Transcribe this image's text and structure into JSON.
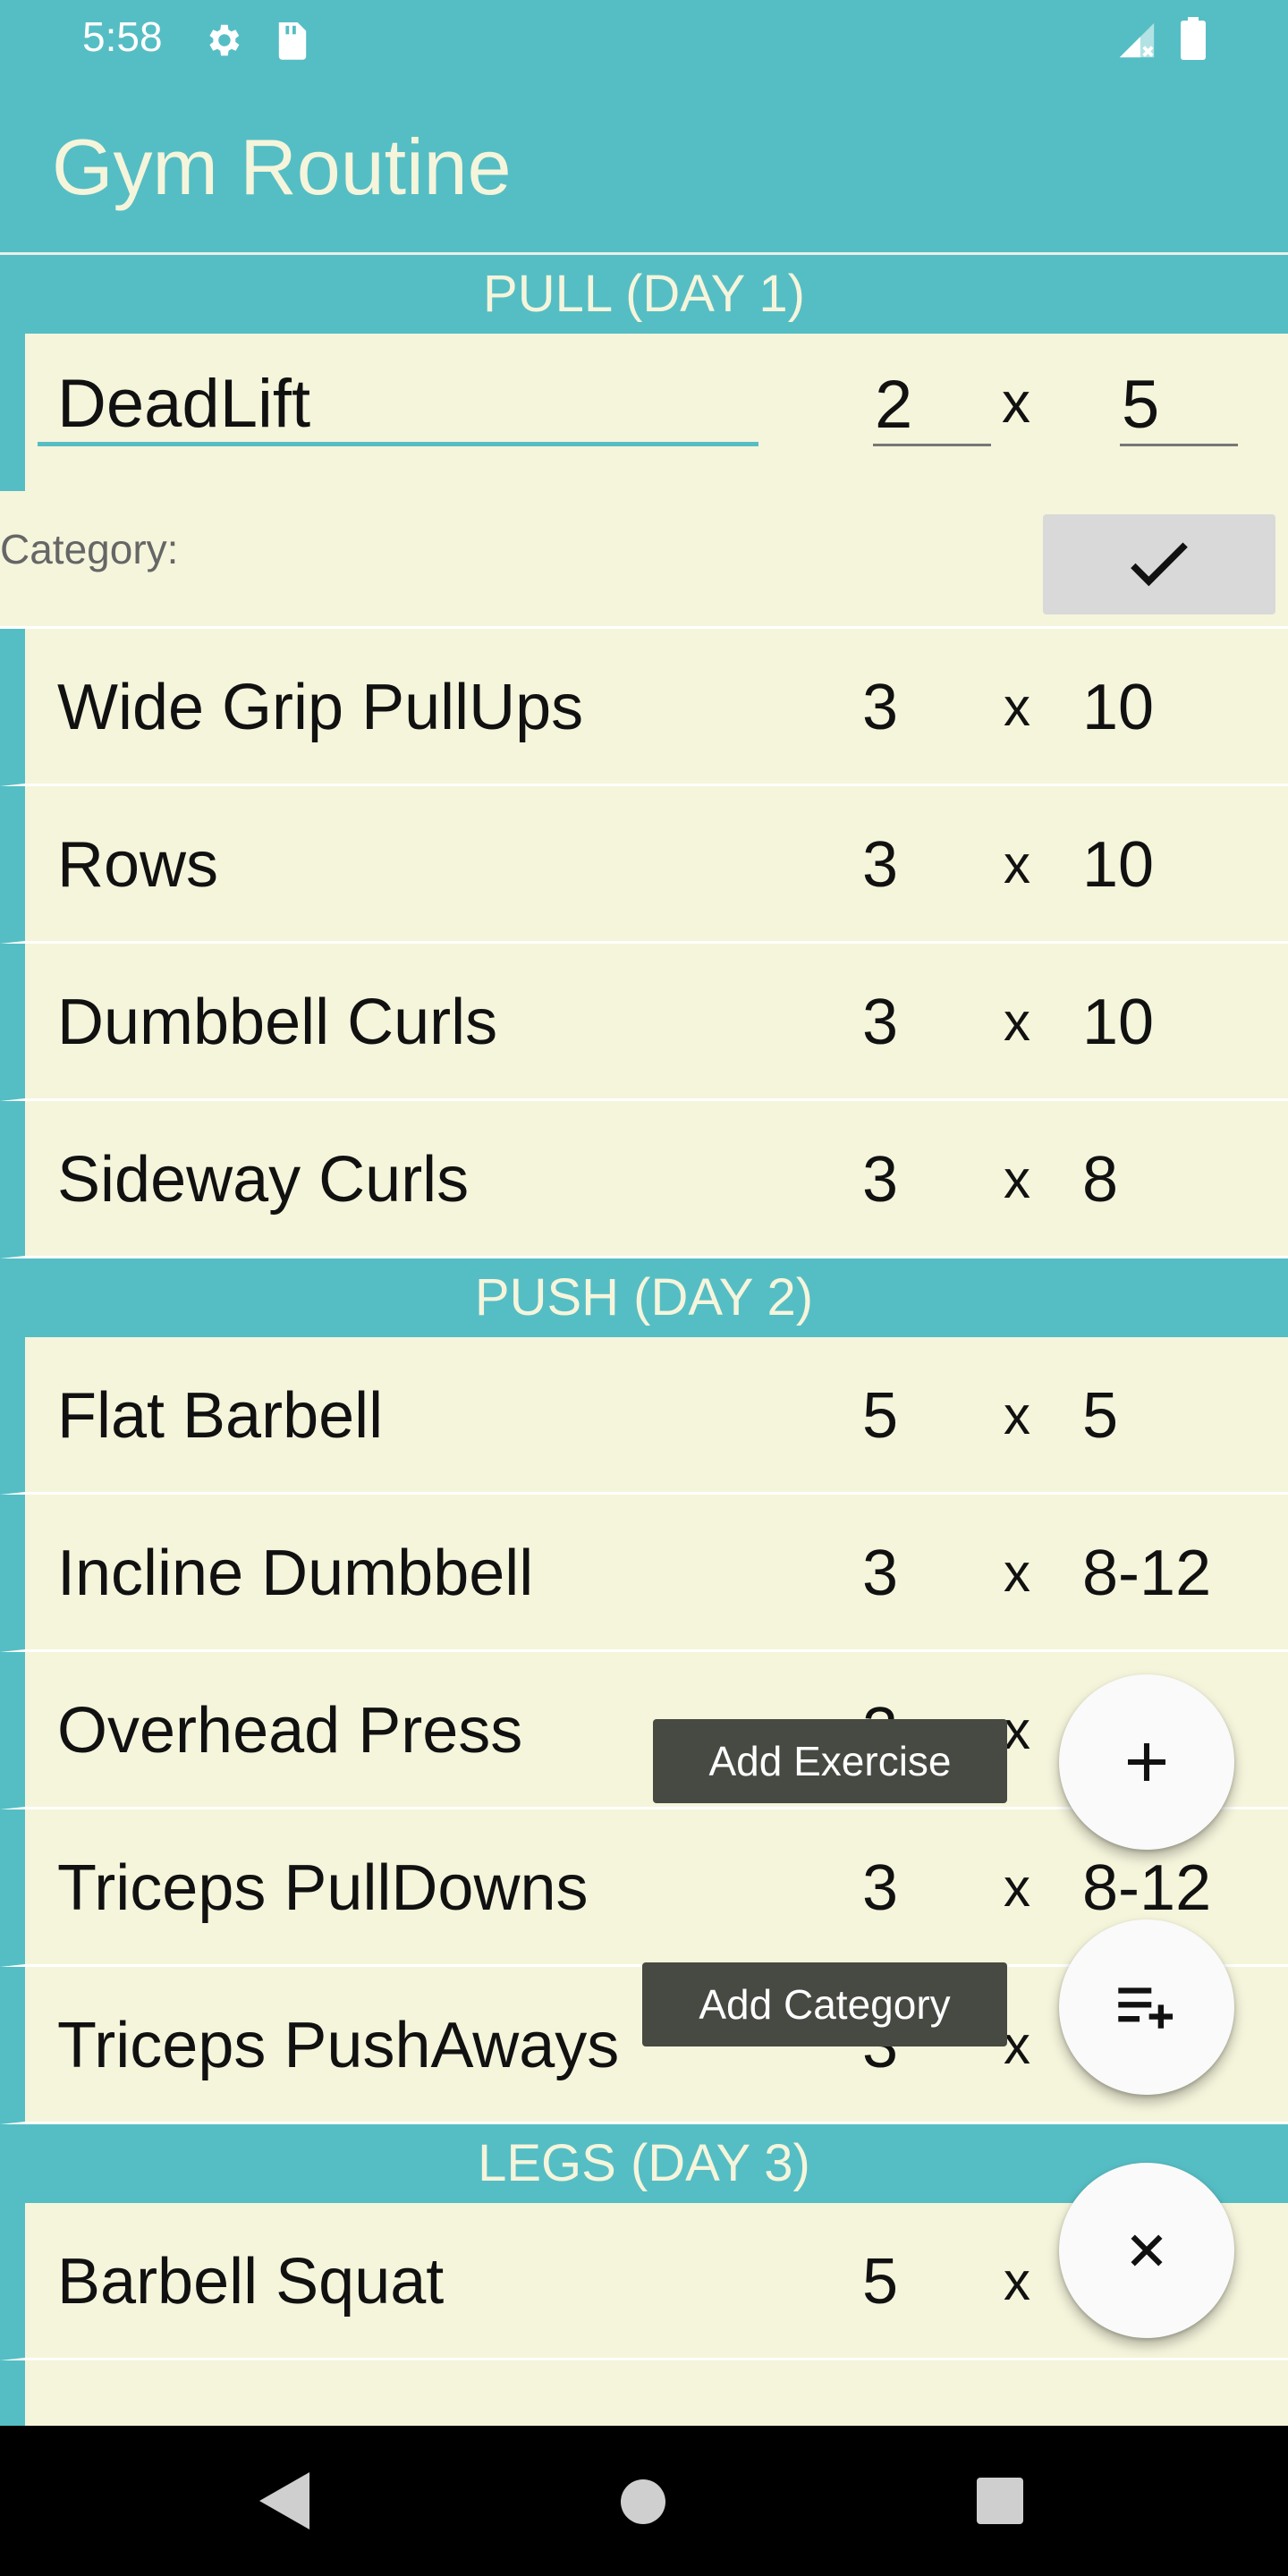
{
  "status_bar": {
    "time": "5:58",
    "icons": [
      "gear-icon",
      "sd-card-icon",
      "signal-icon",
      "battery-icon"
    ]
  },
  "app": {
    "title": "Gym Routine"
  },
  "colors": {
    "primary": "#55bec4",
    "background": "#f5f5dc",
    "label_bg": "#474a42",
    "button_gray": "#d9d9d9"
  },
  "editing": {
    "category_header": "PULL (DAY 1)",
    "name": "DeadLift",
    "sets": "2",
    "x": "x",
    "reps": "5",
    "category_label": "Category:",
    "confirm_icon": "check-icon"
  },
  "categories": [
    {
      "title": "PULL (DAY 1)",
      "exercises": [
        {
          "name": "Wide Grip PullUps",
          "sets": "3",
          "x": "x",
          "reps": "10"
        },
        {
          "name": "Rows",
          "sets": "3",
          "x": "x",
          "reps": "10"
        },
        {
          "name": "Dumbbell Curls",
          "sets": "3",
          "x": "x",
          "reps": "10"
        },
        {
          "name": "Sideway Curls",
          "sets": "3",
          "x": "x",
          "reps": "8"
        }
      ]
    },
    {
      "title": "PUSH (DAY 2)",
      "exercises": [
        {
          "name": "Flat Barbell",
          "sets": "5",
          "x": "x",
          "reps": "5"
        },
        {
          "name": "Incline Dumbbell",
          "sets": "3",
          "x": "x",
          "reps": "8-12"
        },
        {
          "name": "Overhead Press",
          "sets": "3",
          "x": "x",
          "reps": ""
        },
        {
          "name": "Triceps PullDowns",
          "sets": "3",
          "x": "x",
          "reps": "8-12"
        },
        {
          "name": "Triceps PushAways",
          "sets": "3",
          "x": "x",
          "reps": ""
        }
      ]
    },
    {
      "title": "LEGS (DAY 3)",
      "exercises": [
        {
          "name": "Barbell Squat",
          "sets": "5",
          "x": "x",
          "reps": ""
        }
      ]
    }
  ],
  "fab_menu": {
    "add_exercise_label": "Add Exercise",
    "add_category_label": "Add Category",
    "add_exercise_icon": "plus-icon",
    "add_category_icon": "playlist-add-icon",
    "close_icon": "close-icon"
  },
  "nav_bar": {
    "icons": [
      "back-icon",
      "home-icon",
      "recents-icon"
    ]
  }
}
